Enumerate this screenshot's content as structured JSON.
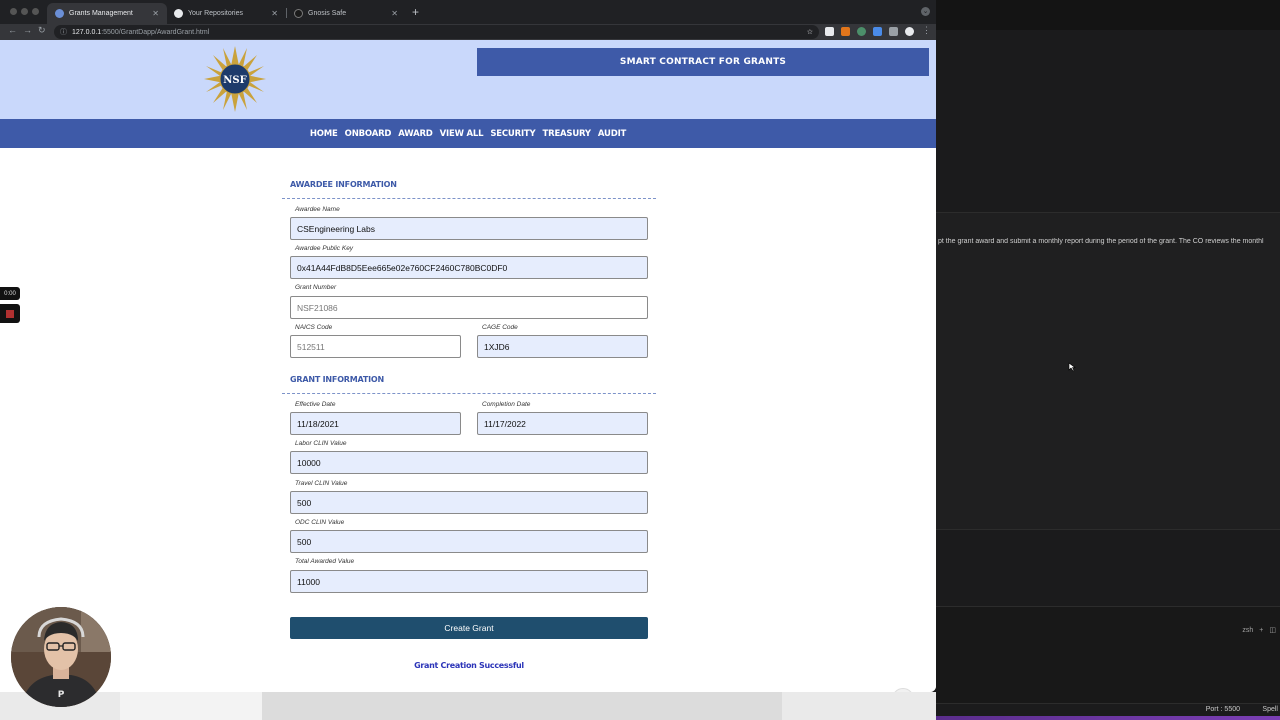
{
  "browser": {
    "tabs": [
      {
        "title": "Grants Management",
        "active": true
      },
      {
        "title": "Your Repositories",
        "active": false
      },
      {
        "title": "Gnosis Safe",
        "active": false
      }
    ],
    "url_host": "127.0.0.1",
    "url_path": ":5500/GrantDapp/AwardGrant.html"
  },
  "header": {
    "logo_text": "NSF",
    "title": "SMART CONTRACT FOR GRANTS"
  },
  "nav": [
    "HOME",
    "ONBOARD",
    "AWARD",
    "VIEW ALL",
    "SECURITY",
    "TREASURY",
    "AUDIT"
  ],
  "awardee": {
    "section_title": "AWARDEE INFORMATION",
    "name_label": "Awardee Name",
    "name_value": "CSEngineering Labs",
    "key_label": "Awardee Public Key",
    "key_value": "0x41A44FdB8D5Eee665e02e760CF2460C780BC0DF0",
    "grant_label": "Grant Number",
    "grant_placeholder": "NSF21086",
    "naics_label": "NAICS Code",
    "naics_placeholder": "512511",
    "cage_label": "CAGE Code",
    "cage_value": "1XJD6"
  },
  "grant": {
    "section_title": "GRANT INFORMATION",
    "effective_label": "Effective Date",
    "effective_value": "11/18/2021",
    "completion_label": "Completion Date",
    "completion_value": "11/17/2022",
    "labor_label": "Labor CLIN Value",
    "labor_value": "10000",
    "travel_label": "Travel CLIN Value",
    "travel_value": "500",
    "odc_label": "ODC CLIN Value",
    "odc_value": "500",
    "total_label": "Total Awarded Value",
    "total_value": "11000"
  },
  "actions": {
    "create_label": "Create Grant",
    "success_message": "Grant Creation Successful",
    "help_label": "?"
  },
  "editor": {
    "preview_text": "pt the grant award and submit a monthly report during the period of the grant. The CO reviews the monthl",
    "terminal_label": "zsh",
    "port_label": "Port : 5500",
    "spell_label": "Spell"
  },
  "recording": {
    "timer": "0:00"
  }
}
